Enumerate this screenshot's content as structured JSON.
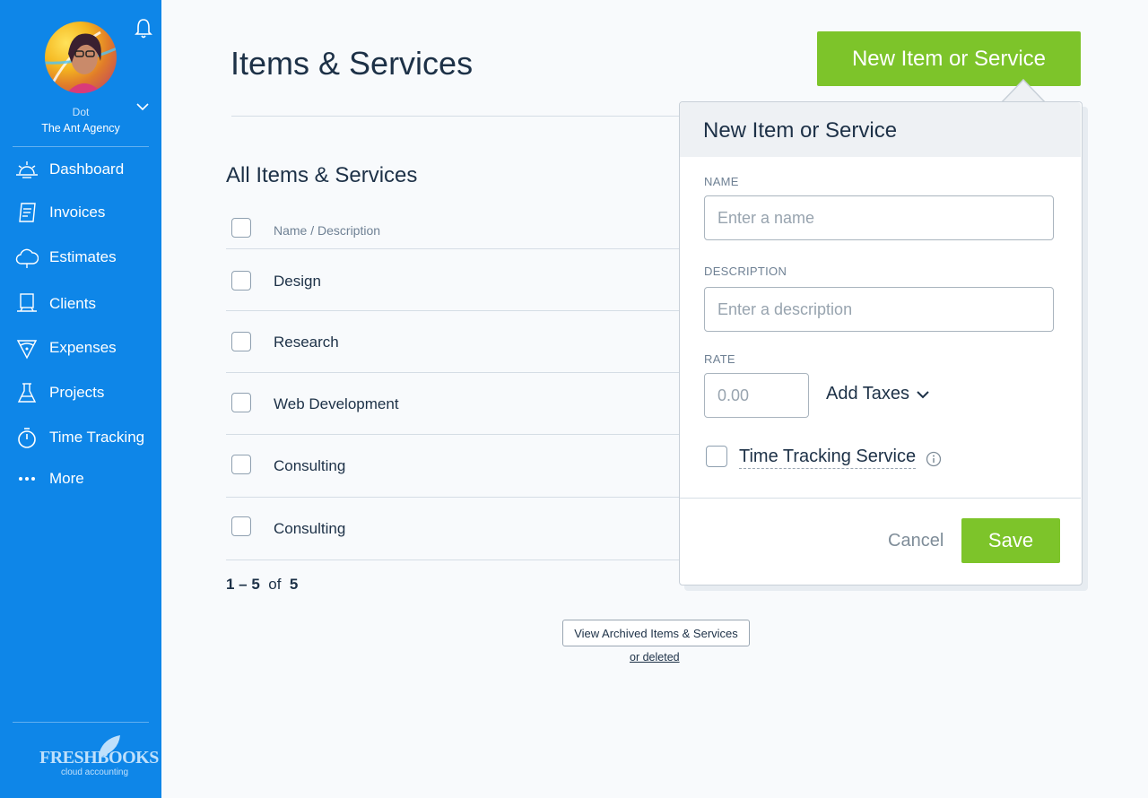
{
  "user": {
    "name": "Dot",
    "org": "The Ant Agency"
  },
  "nav": {
    "items": [
      {
        "label": "Dashboard",
        "icon": "sunrise-icon"
      },
      {
        "label": "Invoices",
        "icon": "invoice-icon"
      },
      {
        "label": "Estimates",
        "icon": "cloud-icon"
      },
      {
        "label": "Clients",
        "icon": "clients-icon"
      },
      {
        "label": "Expenses",
        "icon": "expenses-icon"
      },
      {
        "label": "Projects",
        "icon": "flask-icon"
      },
      {
        "label": "Time Tracking",
        "icon": "stopwatch-icon"
      },
      {
        "label": "More",
        "icon": "more-icon"
      }
    ]
  },
  "logo": {
    "text": "FRESHBOOKS",
    "sub": "cloud accounting"
  },
  "page": {
    "title": "Items & Services",
    "new_button": "New Item or Service",
    "section_title": "All Items & Services",
    "column_header": "Name / Description",
    "rows": [
      "Design",
      "Research",
      "Web Development",
      "Consulting",
      "Consulting"
    ],
    "pager": {
      "range": "1 – 5",
      "of": "of",
      "total": "5"
    },
    "archive_button": "View Archived Items & Services",
    "deleted_link": "or deleted"
  },
  "popover": {
    "title": "New Item or Service",
    "name_label": "NAME",
    "name_placeholder": "Enter a name",
    "description_label": "DESCRIPTION",
    "description_placeholder": "Enter a description",
    "rate_label": "RATE",
    "rate_placeholder": "0.00",
    "add_taxes": "Add Taxes",
    "time_tracking_label": "Time Tracking Service",
    "cancel": "Cancel",
    "save": "Save"
  },
  "colors": {
    "sidebar": "#0e86e8",
    "accent_green": "#7dc42a",
    "text": "#1d3147"
  }
}
